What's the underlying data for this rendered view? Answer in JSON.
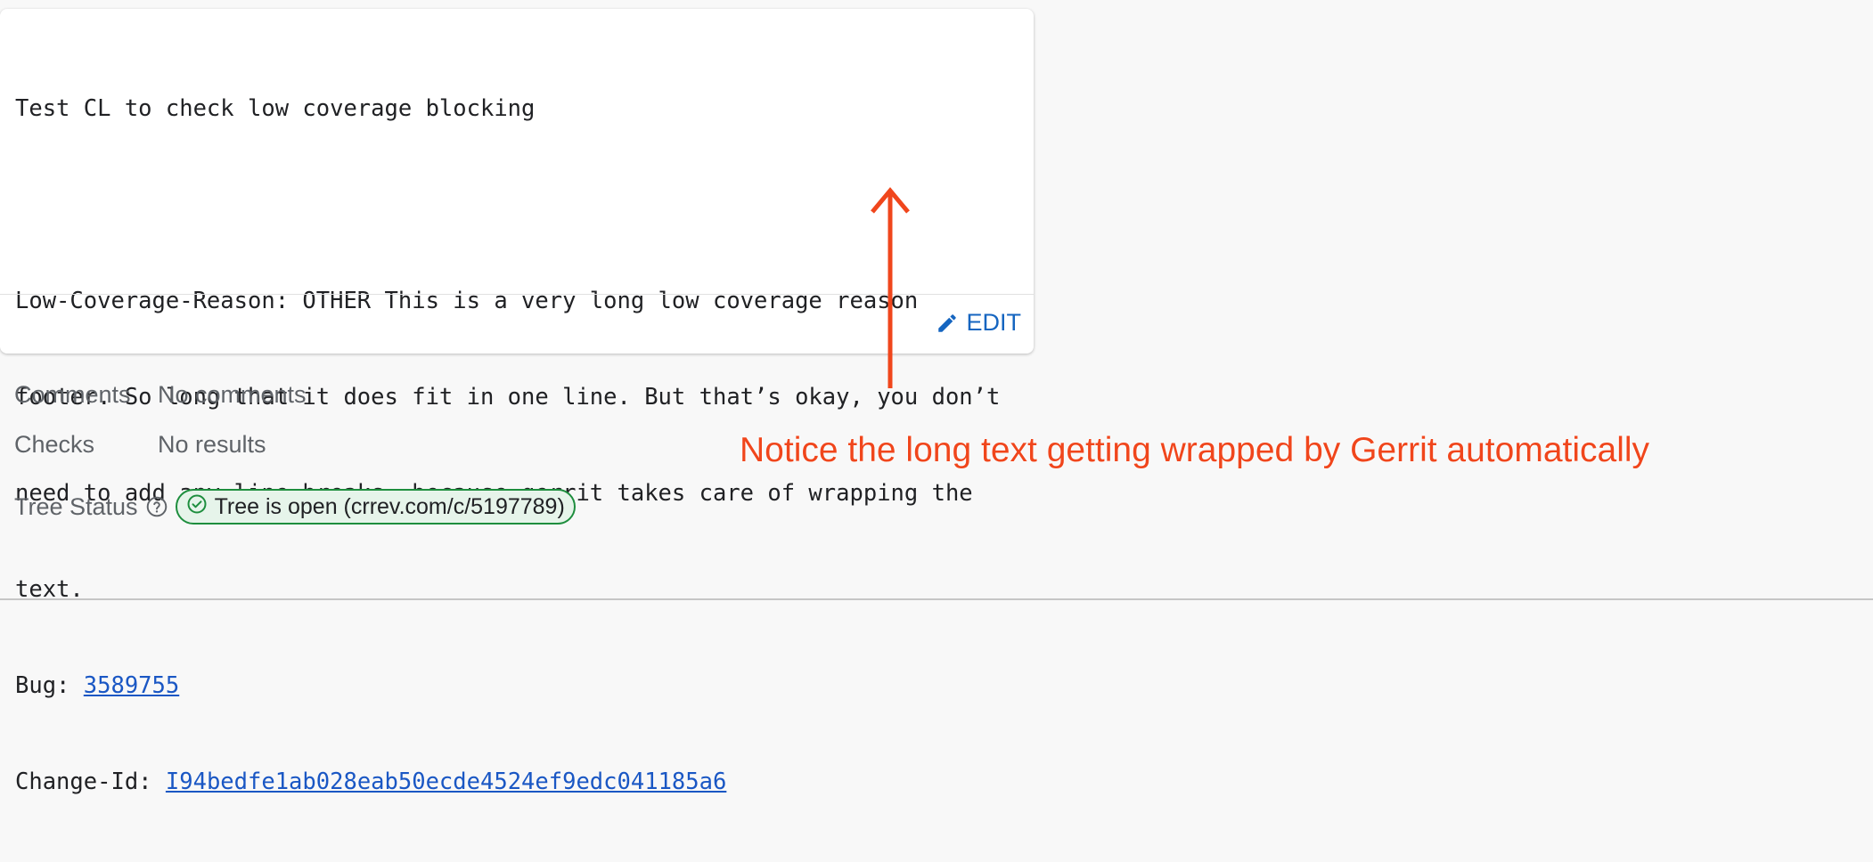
{
  "commit_message": {
    "subject": "Test CL to check low coverage blocking",
    "body_lines": [
      "Low-Coverage-Reason: OTHER This is a very long low coverage reason",
      "footer. So long that it does fit in one line. But that’s okay, you don’t",
      "need to add any line breaks, because gerrit takes care of wrapping the",
      "text."
    ],
    "bug_label": "Bug: ",
    "bug_value": "3589755",
    "change_id_label": "Change-Id: ",
    "change_id_value": "I94bedfe1ab028eab50ecde4524ef9edc041185a6"
  },
  "edit_button": {
    "label": "EDIT",
    "icon": "pencil-icon"
  },
  "meta": {
    "comments_label": "Comments",
    "comments_value": "No comments",
    "checks_label": "Checks",
    "checks_value": "No results",
    "tree_status_label": "Tree Status",
    "tree_status_help_icon": "help-circle-icon",
    "tree_status_value": "Tree is open (crrev.com/c/5197789)",
    "tree_status_icon": "check-circle-icon"
  },
  "annotation": {
    "text": "Notice the long text getting wrapped by Gerrit automatically",
    "color": "#f0461c"
  },
  "colors": {
    "link": "#1a57c4",
    "accent": "#1565c0",
    "status_green": "#1e8e3e",
    "background": "#f8f8f8"
  }
}
